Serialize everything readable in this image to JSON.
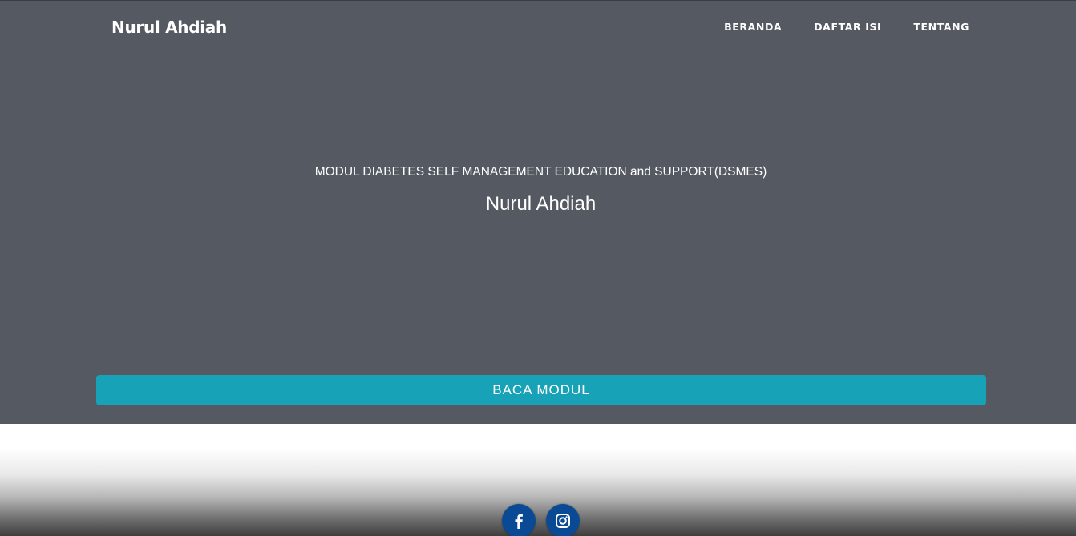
{
  "header": {
    "brand": "Nurul Ahdiah",
    "nav": [
      {
        "label": "BERANDA"
      },
      {
        "label": "DAFTAR ISI"
      },
      {
        "label": "TENTANG"
      }
    ]
  },
  "hero": {
    "subtitle": "MODUL DIABETES SELF MANAGEMENT EDUCATION and SUPPORT(DSMES)",
    "author": "Nurul Ahdiah",
    "button_label": "BACA MODUL"
  },
  "footer": {
    "social": [
      {
        "icon": "facebook-icon"
      },
      {
        "icon": "instagram-icon"
      }
    ]
  },
  "colors": {
    "hero_background": "#555a62",
    "button": "#17a2b8",
    "social_circle": "#0a4a94"
  }
}
